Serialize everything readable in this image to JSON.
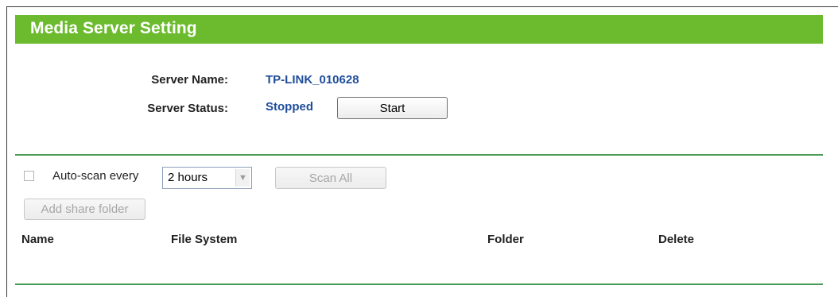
{
  "header": {
    "title": "Media Server Setting"
  },
  "server": {
    "name_label": "Server Name:",
    "name_value": "TP-LINK_010628",
    "status_label": "Server Status:",
    "status_value": "Stopped",
    "start_label": "Start"
  },
  "scan": {
    "autoscan_label": "Auto-scan every",
    "interval_selected": "2 hours",
    "autoscan_checked": false,
    "scan_all_label": "Scan All",
    "add_folder_label": "Add share folder"
  },
  "table": {
    "columns": [
      "Name",
      "File System",
      "Folder",
      "Delete"
    ]
  },
  "colors": {
    "accent": "#6cbb2e",
    "divider": "#4a9a57",
    "value": "#1f4d9a"
  }
}
